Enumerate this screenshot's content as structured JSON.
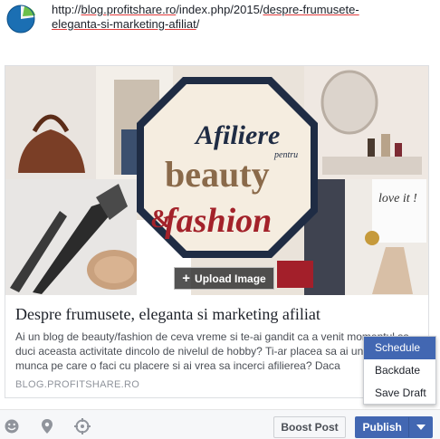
{
  "post": {
    "url_line1_prefix": "http://",
    "url_line1_link": "blog.profitshare.ro",
    "url_line1_mid": "/index.php/2015/",
    "url_line1_end": "despre-frumusete-",
    "url_line2": "eleganta-si-marketing-afiliat",
    "url_line2_suffix": "/"
  },
  "card": {
    "image_text": {
      "line1": "Afiliere",
      "line2": "pentru",
      "line3": "beauty",
      "line4": "&",
      "line5": "fashion"
    },
    "upload_label": "Upload Image",
    "title": "Despre frumusete, eleganta si marketing afiliat",
    "description": "Ai un blog de beauty/fashion de ceva vreme si te-ai gandit ca a venit momentul sa duci aceasta activitate dincolo de nivelul de hobby? Ti-ar placea sa ai un venit din munca pe care o faci cu placere si ai vrea sa incerci afilierea? Daca",
    "domain": "BLOG.PROFITSHARE.RO"
  },
  "footer": {
    "boost_label": "Boost Post",
    "publish_label": "Publish"
  },
  "publish_menu": {
    "items": [
      "Schedule",
      "Backdate",
      "Save Draft"
    ],
    "selected": "Schedule"
  },
  "colors": {
    "accent": "#4267b2",
    "title_brown": "#8a6a4a",
    "title_red": "#a3222a",
    "plaque_navy": "#1f2c44"
  },
  "icons": [
    "app-logo-icon",
    "emoji-icon",
    "location-pin-icon",
    "target-icon",
    "plus-icon",
    "caret-down-icon"
  ]
}
